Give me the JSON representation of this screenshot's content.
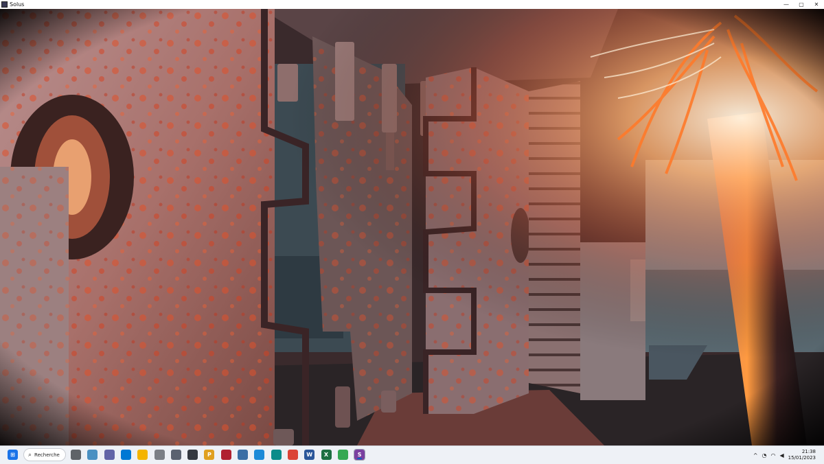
{
  "window": {
    "title": "Solus"
  },
  "window_controls": {
    "minimize": "—",
    "maximize": "▢",
    "close": "✕"
  },
  "taskbar": {
    "search_label": "Recherche",
    "apps": [
      {
        "name": "start",
        "glyph": "",
        "color": "#1a73e8"
      },
      {
        "name": "task-view",
        "glyph": "",
        "color": "#5f6368"
      },
      {
        "name": "widgets",
        "glyph": "",
        "color": "#4a90c2"
      },
      {
        "name": "chat",
        "glyph": "",
        "color": "#6264a7"
      },
      {
        "name": "store",
        "glyph": "",
        "color": "#0078d4"
      },
      {
        "name": "explorer",
        "glyph": "",
        "color": "#f4b400"
      },
      {
        "name": "app-tool",
        "glyph": "",
        "color": "#7b7f86"
      },
      {
        "name": "settings",
        "glyph": "",
        "color": "#5a6270"
      },
      {
        "name": "app-bolt",
        "glyph": "",
        "color": "#333840"
      },
      {
        "name": "app-p",
        "glyph": "P",
        "color": "#e0a020"
      },
      {
        "name": "app-game",
        "glyph": "",
        "color": "#b02030"
      },
      {
        "name": "app-calc",
        "glyph": "",
        "color": "#3a6ea5"
      },
      {
        "name": "app-photos",
        "glyph": "",
        "color": "#1c8ad8"
      },
      {
        "name": "edge",
        "glyph": "",
        "color": "#0c8c8a"
      },
      {
        "name": "chrome",
        "glyph": "",
        "color": "#db4437"
      },
      {
        "name": "word",
        "glyph": "W",
        "color": "#2b579a"
      },
      {
        "name": "excel",
        "glyph": "X",
        "color": "#1d6f42"
      },
      {
        "name": "chrome-alt",
        "glyph": "",
        "color": "#34a853"
      },
      {
        "name": "solus",
        "glyph": "S",
        "color": "#7a3fa0"
      }
    ],
    "clock": {
      "time": "21:38",
      "date": "15/01/2023"
    },
    "tray_chevron": "^"
  },
  "colors": {
    "rust": "#c8482a",
    "metal": "#8c7f80",
    "glow": "#ff8a30",
    "shadow": "#1e1a1c"
  }
}
